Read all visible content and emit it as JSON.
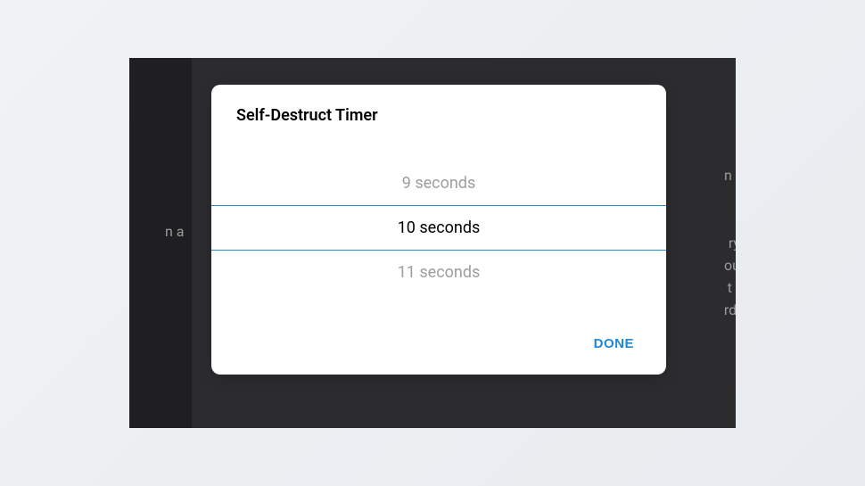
{
  "dialog": {
    "title": "Self-Destruct Timer",
    "picker": {
      "prev": "9 seconds",
      "selected": "10 seconds",
      "next": "11 seconds"
    },
    "done_label": "DONE"
  },
  "background": {
    "left_fragment": "n a",
    "right_fragments": [
      "n t",
      "ry",
      "ou",
      "t t",
      "rdi"
    ]
  }
}
